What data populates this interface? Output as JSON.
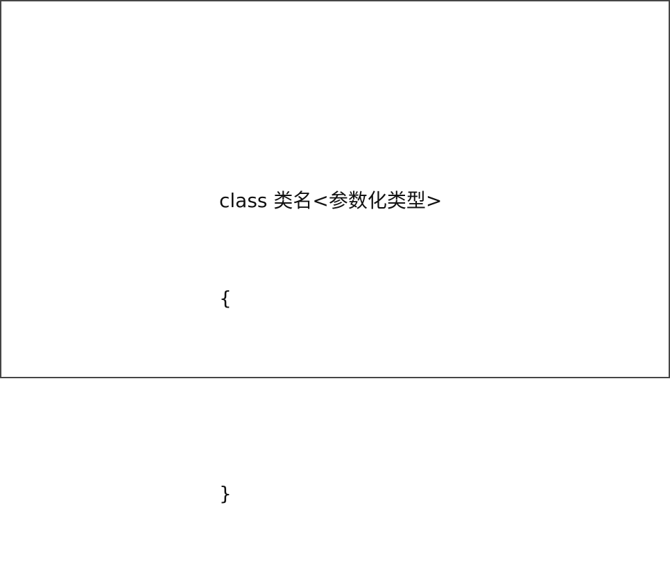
{
  "slide": {
    "lines": [
      "class 类名<参数化类型>",
      "{",
      "",
      "}"
    ]
  }
}
